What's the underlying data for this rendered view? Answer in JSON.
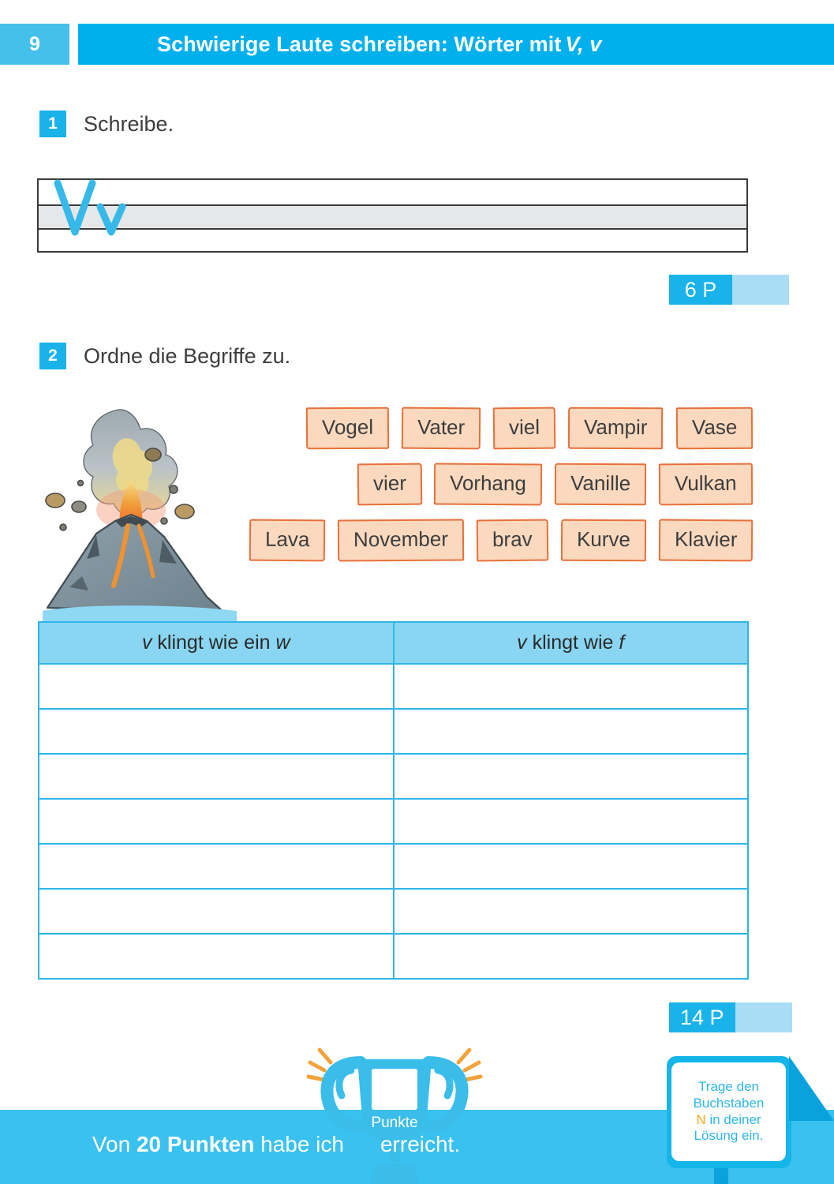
{
  "header": {
    "page_number": "9",
    "title_main": "Schwierige Laute schreiben: Wörter mit",
    "title_italic": "V, v",
    "bg_color": "#00b0ec",
    "page_num_bg": "#45c0ea"
  },
  "task1": {
    "number": "1",
    "instruction": "Schreibe.",
    "practice_letters": "Vv",
    "points": {
      "value": "6 P"
    }
  },
  "task2": {
    "number": "2",
    "instruction": "Ordne die Begriffe zu.",
    "illustration": "volcano-illustration",
    "word_cards": [
      [
        "Vogel",
        "Vater",
        "viel",
        "Vampir",
        "Vase"
      ],
      [
        "vier",
        "Vorhang",
        "Vanille",
        "Vulkan"
      ],
      [
        "Lava",
        "November",
        "brav",
        "Kurve",
        "Klavier"
      ]
    ],
    "table": {
      "col1_prefix": "v",
      "col1_mid": " klingt wie ein ",
      "col1_suffix": "w",
      "col2_prefix": "v",
      "col2_mid": " klingt wie ",
      "col2_suffix": "f",
      "empty_rows": 7
    },
    "points": {
      "value": "14 P"
    }
  },
  "footer": {
    "prefix": "Von ",
    "bold": "20 Punkten",
    "middle": " habe ich",
    "suffix": "erreicht.",
    "trophy_label": "Punkte",
    "bar_color": "#39c1ef"
  },
  "note": {
    "line1": "Trage den",
    "line2": "Buchstaben",
    "letter": "N",
    "line3_rest": " in deiner",
    "line4": "Lösung ein.",
    "letter_color": "#f5a623"
  },
  "colors": {
    "accent_cyan": "#00b0ec",
    "light_cyan": "#8ad6f2",
    "card_fill": "#fbd9bf",
    "card_border": "#e8703a",
    "table_border": "#2eb6e8"
  }
}
